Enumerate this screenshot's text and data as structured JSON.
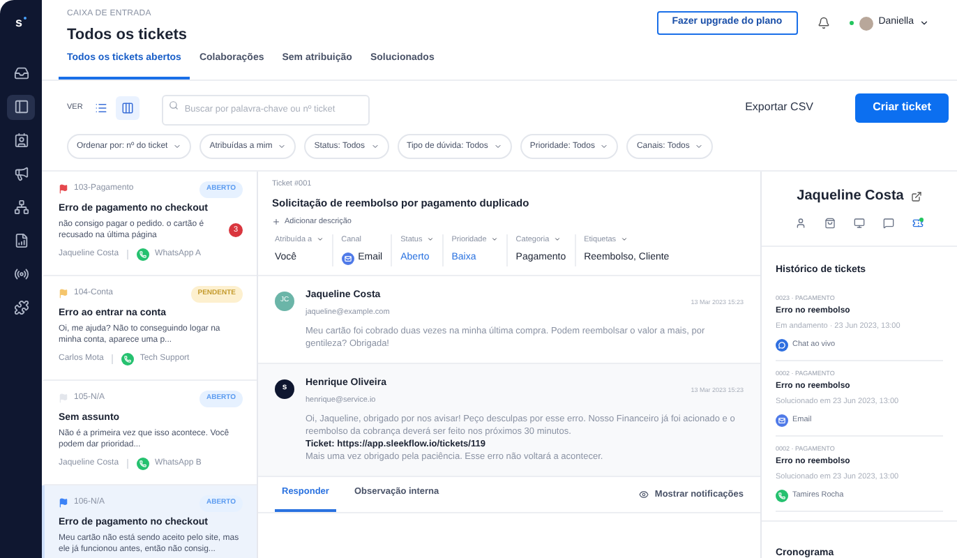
{
  "header": {
    "section_label": "CAIXA DE ENTRADA",
    "title": "Todos os tickets",
    "upgrade_button": "Fazer upgrade do plano",
    "user": {
      "name": "Daniella",
      "online": true
    }
  },
  "sidebar": {
    "logo": "s",
    "items": [
      {
        "kind": "inbox",
        "selected": false
      },
      {
        "kind": "tickets",
        "selected": true
      },
      {
        "kind": "contacts",
        "selected": false
      },
      {
        "kind": "broadcast",
        "selected": false
      },
      {
        "kind": "flow",
        "selected": false
      },
      {
        "kind": "analytics",
        "selected": false
      },
      {
        "kind": "channels",
        "selected": false
      },
      {
        "kind": "integrations",
        "selected": false
      }
    ]
  },
  "tabs": [
    {
      "label": "Todos os tickets abertos",
      "selected": true
    },
    {
      "label": "Colaborações",
      "selected": false
    },
    {
      "label": "Sem atribuição",
      "selected": false
    },
    {
      "label": "Solucionados",
      "selected": false
    }
  ],
  "toolbar": {
    "view_label": "VER",
    "views": [
      {
        "kind": "list",
        "selected": false
      },
      {
        "kind": "columns",
        "selected": true
      }
    ],
    "search": {
      "placeholder": "Buscar por palavra-chave ou nº ticket"
    },
    "export_button": "Exportar CSV",
    "create_button": "Criar ticket"
  },
  "filters": [
    "Ordenar por: nº do ticket",
    "Atribuídas a mim",
    "Status: Todos",
    "Tipo de dúvida: Todos",
    "Prioridade: Todos",
    "Canais: Todos"
  ],
  "tickets": [
    {
      "id_label": "103-Pagamento",
      "color": "#e5484d",
      "status": {
        "label": "ABERTO",
        "kind": "open"
      },
      "title": "Erro de pagamento no checkout",
      "preview": "não consigo pagar o pedido. o cartão é recusado na última página",
      "contact": "Jaqueline Costa",
      "channel": "WhatsApp  A",
      "unread": "3",
      "selected": false
    },
    {
      "id_label": "104-Conta",
      "color": "#f5c56b",
      "status": {
        "label": "PENDENTE",
        "kind": "pending"
      },
      "title": "Erro ao entrar na conta",
      "preview": "Oi, me ajuda? Não to conseguindo logar na minha conta, aparece uma p...",
      "contact": "Carlos Mota",
      "channel": "Tech Support",
      "selected": false
    },
    {
      "id_label": "105-N/A",
      "color": "#e3e6ec",
      "status": {
        "label": "ABERTO",
        "kind": "open"
      },
      "title": "Sem assunto",
      "preview": "Não é a primeira vez que isso acontece. Você podem dar prioridad...",
      "contact": "Jaqueline Costa",
      "channel": "WhatsApp B",
      "selected": false
    },
    {
      "id_label": "106-N/A",
      "color": "#3b82f6",
      "status": {
        "label": "ABERTO",
        "kind": "open"
      },
      "title": "Erro de pagamento no checkout",
      "preview": "Meu cartão não está sendo aceito pelo site, mas ele já funcionou antes, então não consig...",
      "selected": true
    }
  ],
  "detail": {
    "ticket_number": "Ticket #001",
    "title": "Solicitação de reembolso por pagamento duplicado",
    "add_description": "Adicionar descrição",
    "fields": [
      {
        "label": "Atribuída a",
        "dropdown": true,
        "value": "Você",
        "kind": "plain"
      },
      {
        "label": "Canal",
        "dropdown": false,
        "value": "Email",
        "kind": "email"
      },
      {
        "label": "Status",
        "dropdown": true,
        "value": "Aberto",
        "kind": "link"
      },
      {
        "label": "Prioridade",
        "dropdown": true,
        "value": "Baixa",
        "kind": "link"
      },
      {
        "label": "Categoria",
        "dropdown": true,
        "value": "Pagamento",
        "kind": "plain"
      },
      {
        "label": "Etiquetas",
        "dropdown": true,
        "value": "Reembolso, Cliente",
        "kind": "plain"
      }
    ],
    "messages": [
      {
        "avatar": {
          "kind": "initials",
          "text": "JC"
        },
        "name": "Jaqueline Costa",
        "email": "jaqueline@example.com",
        "time": "13 Mar 2023 15:23",
        "paragraphs": [
          "Meu cartão foi cobrado duas vezes na minha última compra. Podem reembolsar o valor a mais, por gentileza? Obrigada!"
        ]
      },
      {
        "avatar": {
          "kind": "logo",
          "text": "s"
        },
        "name": "Henrique Oliveira",
        "email": "henrique@service.io",
        "time": "13 Mar 2023 15:23",
        "paragraphs": [
          "Oi, Jaqueline, obrigado por nos avisar! Peço desculpas por esse erro. Nosso Financeiro já foi acionado e o reembolso da cobrança deverá ser feito nos próximos 30 minutos.",
          "**Ticket: https://app.sleekflow.io/tickets/119**",
          "Mais uma vez obrigado pela paciência. Esse erro não voltará a acontecer."
        ]
      }
    ],
    "reply_tabs": [
      {
        "label": "Responder",
        "selected": true
      },
      {
        "label": "Observação interna",
        "selected": false
      }
    ],
    "show_notifications": "Mostrar notificações"
  },
  "contact_panel": {
    "name": "Jaqueline Costa",
    "icons": [
      {
        "kind": "person",
        "selected": false
      },
      {
        "kind": "bag",
        "selected": false
      },
      {
        "kind": "monitor",
        "selected": false
      },
      {
        "kind": "chat",
        "selected": false
      },
      {
        "kind": "ticket",
        "selected": true
      }
    ],
    "history_title": "Histórico de tickets",
    "history": [
      {
        "meta": "0023 · PAGAMENTO",
        "title": "Erro no reembolso",
        "status": "Em andamento · 23 Jun 2023, 13:00",
        "channel": {
          "label": "Chat ao vivo",
          "kind": "chat"
        }
      },
      {
        "meta": "0002 · PAGAMENTO",
        "title": "Erro no reembolso",
        "status": "Solucionado em 23 Jun 2023, 13:00",
        "channel": {
          "label": "Email",
          "kind": "email"
        }
      },
      {
        "meta": "0002 · PAGAMENTO",
        "title": "Erro no reembolso",
        "status": "Solucionado em 23 Jun 2023, 13:00",
        "channel": {
          "label": "Tamires Rocha",
          "kind": "whatsapp"
        }
      }
    ],
    "timeline_title": "Cronograma"
  }
}
